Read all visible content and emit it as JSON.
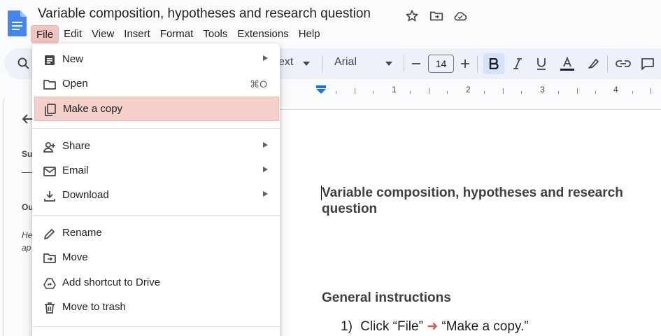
{
  "doc": {
    "title": "Variable composition, hypotheses and research question"
  },
  "menubar": [
    "File",
    "Edit",
    "View",
    "Insert",
    "Format",
    "Tools",
    "Extensions",
    "Help"
  ],
  "toolbar": {
    "style_partial": "ext",
    "font": "Arial",
    "font_size": "14"
  },
  "ruler": [
    "1",
    "2",
    "3",
    "4"
  ],
  "left_panel": {
    "summary_partial": "Su",
    "outline_partial": "Ou",
    "hint_line1": "He",
    "hint_line2": "ap"
  },
  "file_menu": {
    "new": "New",
    "open": "Open",
    "open_shortcut": "⌘O",
    "make_copy": "Make a copy",
    "share": "Share",
    "email": "Email",
    "download": "Download",
    "rename": "Rename",
    "move": "Move",
    "add_shortcut": "Add shortcut to Drive",
    "trash": "Move to trash"
  },
  "page": {
    "heading": "Variable composition, hypotheses and research question",
    "subheading": "General instructions",
    "step_number": "1)",
    "step_before": "Click “File”",
    "step_arrow": "➜",
    "step_after": "“Make a copy.”"
  },
  "colors": {
    "highlight": "#f4d0cb",
    "accent_blue": "#1a73e8",
    "bold_active": "#d3e3fd"
  }
}
